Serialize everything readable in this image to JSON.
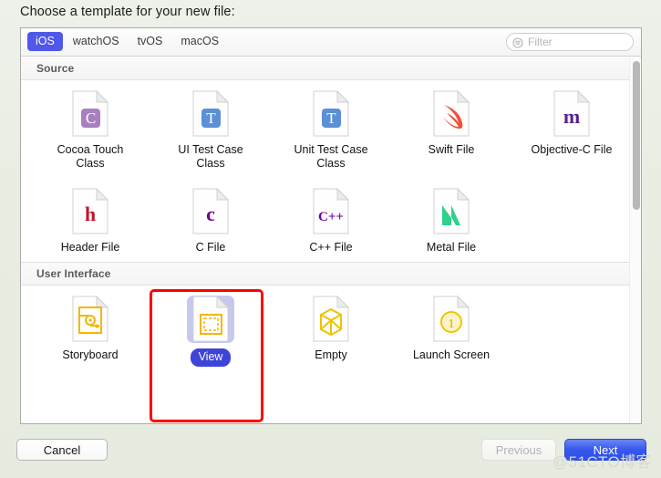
{
  "dialog": {
    "title": "Choose a template for your new file:"
  },
  "tabs": [
    {
      "label": "iOS",
      "active": true
    },
    {
      "label": "watchOS",
      "active": false
    },
    {
      "label": "tvOS",
      "active": false
    },
    {
      "label": "macOS",
      "active": false
    }
  ],
  "filter": {
    "placeholder": "Filter",
    "value": "",
    "icon": "filter-search-icon"
  },
  "sections": [
    {
      "title": "Source",
      "items": [
        {
          "label": "Cocoa Touch\nClass",
          "icon": "file-c-icon",
          "glyph": "C",
          "glyph_color": "#a97fc0",
          "badge": true,
          "selected": false
        },
        {
          "label": "UI Test Case\nClass",
          "icon": "file-t-icon",
          "glyph": "T",
          "glyph_color": "#5b8fd6",
          "badge": true,
          "selected": false
        },
        {
          "label": "Unit Test Case\nClass",
          "icon": "file-t-icon",
          "glyph": "T",
          "glyph_color": "#5b8fd6",
          "badge": true,
          "selected": false
        },
        {
          "label": "Swift File",
          "icon": "file-swift-icon",
          "glyph": "",
          "glyph_color": "#f05138",
          "badge": false,
          "selected": false
        },
        {
          "label": "Objective-C File",
          "icon": "file-m-icon",
          "glyph": "m",
          "glyph_color": "#5b1f8f",
          "badge": false,
          "selected": false
        },
        {
          "label": "Header File",
          "icon": "file-h-icon",
          "glyph": "h",
          "glyph_color": "#c4122f",
          "badge": false,
          "selected": false
        },
        {
          "label": "C File",
          "icon": "file-c-lower-icon",
          "glyph": "c",
          "glyph_color": "#6d009b",
          "badge": false,
          "selected": false
        },
        {
          "label": "C++ File",
          "icon": "file-cpp-icon",
          "glyph": "C++",
          "glyph_color": "#6d009b",
          "badge": false,
          "selected": false
        },
        {
          "label": "Metal File",
          "icon": "file-metal-icon",
          "glyph": "M",
          "glyph_color": "#2fd18b",
          "badge": false,
          "selected": false
        }
      ]
    },
    {
      "title": "User Interface",
      "items": [
        {
          "label": "Storyboard",
          "icon": "file-storyboard-icon",
          "glyph": "",
          "glyph_color": "#f2b705",
          "badge": false,
          "selected": false
        },
        {
          "label": "View",
          "icon": "file-view-icon",
          "glyph": "",
          "glyph_color": "#f2b705",
          "badge": false,
          "selected": true
        },
        {
          "label": "Empty",
          "icon": "file-empty-cube-icon",
          "glyph": "",
          "glyph_color": "#f2c200",
          "badge": false,
          "selected": false
        },
        {
          "label": "Launch Screen",
          "icon": "file-launch-screen-icon",
          "glyph": "1",
          "glyph_color": "#f2c200",
          "badge": false,
          "selected": false
        }
      ]
    }
  ],
  "footer": {
    "cancel": "Cancel",
    "previous": "Previous",
    "next": "Next"
  },
  "watermark": "@51CTO博客",
  "colors": {
    "accent_blue": "#3f44d8",
    "tab_active": "#4f58e8",
    "annotation_red": "#fe0000",
    "selected_icon_bg": "#c6c8ee"
  }
}
